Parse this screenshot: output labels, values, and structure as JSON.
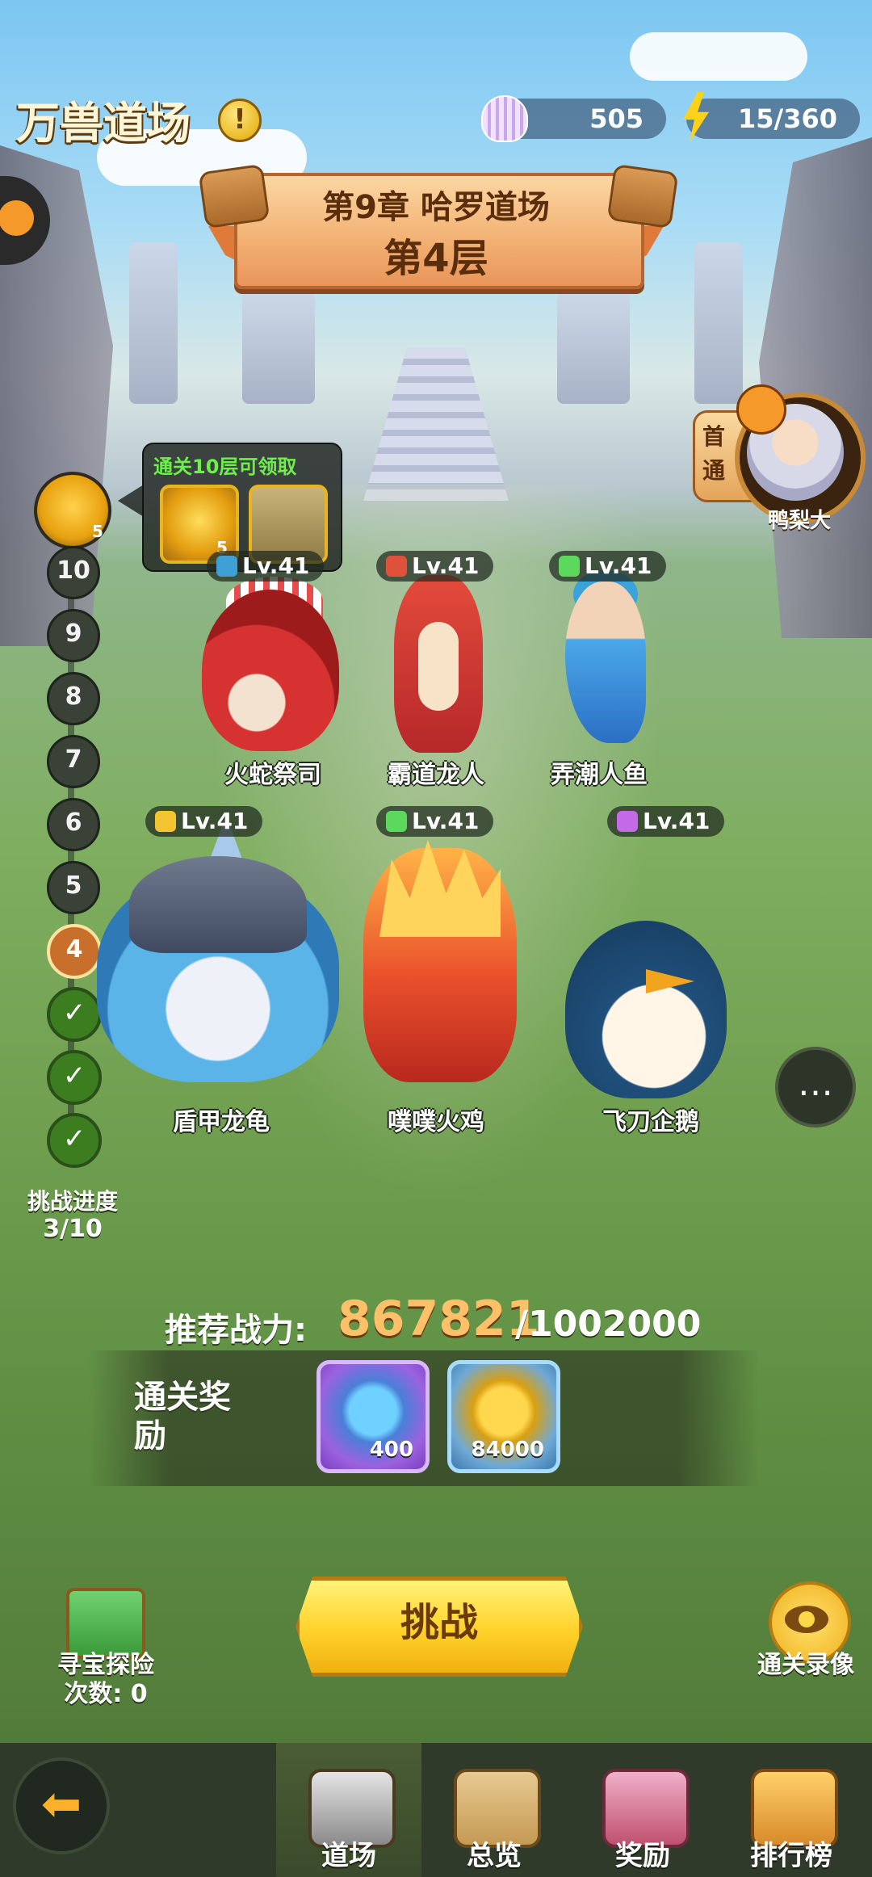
{
  "header": {
    "title": "万兽道场",
    "shell_count": "505",
    "energy": "15/360"
  },
  "banner": {
    "chapter": "第9章 哈罗道场",
    "floor": "第4层"
  },
  "first_clear": {
    "label_line1": "首",
    "label_line2": "通",
    "player_name": "鸭梨大"
  },
  "progress": {
    "reward_egg_count": "5",
    "nodes": [
      "10",
      "9",
      "8",
      "7",
      "6",
      "5",
      "4"
    ],
    "current_floor": "4",
    "cleared_floors": 3,
    "label": "挑战进度",
    "value": "3/10"
  },
  "tooltip": {
    "text": "通关10层可领取",
    "egg_count": "5"
  },
  "monsters": [
    {
      "name": "火蛇祭司",
      "level": "Lv.41",
      "gem_color": "#3fa0d8"
    },
    {
      "name": "霸道龙人",
      "level": "Lv.41",
      "gem_color": "#e0513b"
    },
    {
      "name": "弄潮人鱼",
      "level": "Lv.41",
      "gem_color": "#5cd85c"
    },
    {
      "name": "盾甲龙龟",
      "level": "Lv.41",
      "gem_color": "#f2c531"
    },
    {
      "name": "噗噗火鸡",
      "level": "Lv.41",
      "gem_color": "#5cd85c"
    },
    {
      "name": "飞刀企鹅",
      "level": "Lv.41",
      "gem_color": "#c46ae8"
    }
  ],
  "power": {
    "label": "推荐战力:",
    "value": "867821",
    "required": "/1002000"
  },
  "rewards": {
    "title": "通关奖励",
    "items": [
      {
        "icon": "devil-fruit-icon",
        "quantity": "400"
      },
      {
        "icon": "gold-coin-icon",
        "quantity": "84000"
      }
    ]
  },
  "actions": {
    "treasure_label": "寻宝探险",
    "treasure_count": "次数: 0",
    "challenge_label": "挑战",
    "replay_label": "通关录像"
  },
  "nav": {
    "items": [
      {
        "label": "道场",
        "icon": "dojo-icon",
        "active": true
      },
      {
        "label": "总览",
        "icon": "map-icon",
        "active": false
      },
      {
        "label": "奖励",
        "icon": "reward-chest-icon",
        "active": false
      },
      {
        "label": "排行榜",
        "icon": "ranking-icon",
        "active": false
      }
    ]
  },
  "colors": {
    "accent": "#ffd22a",
    "power_value": "#ffc06a",
    "tooltip_text": "#6cf04a"
  }
}
